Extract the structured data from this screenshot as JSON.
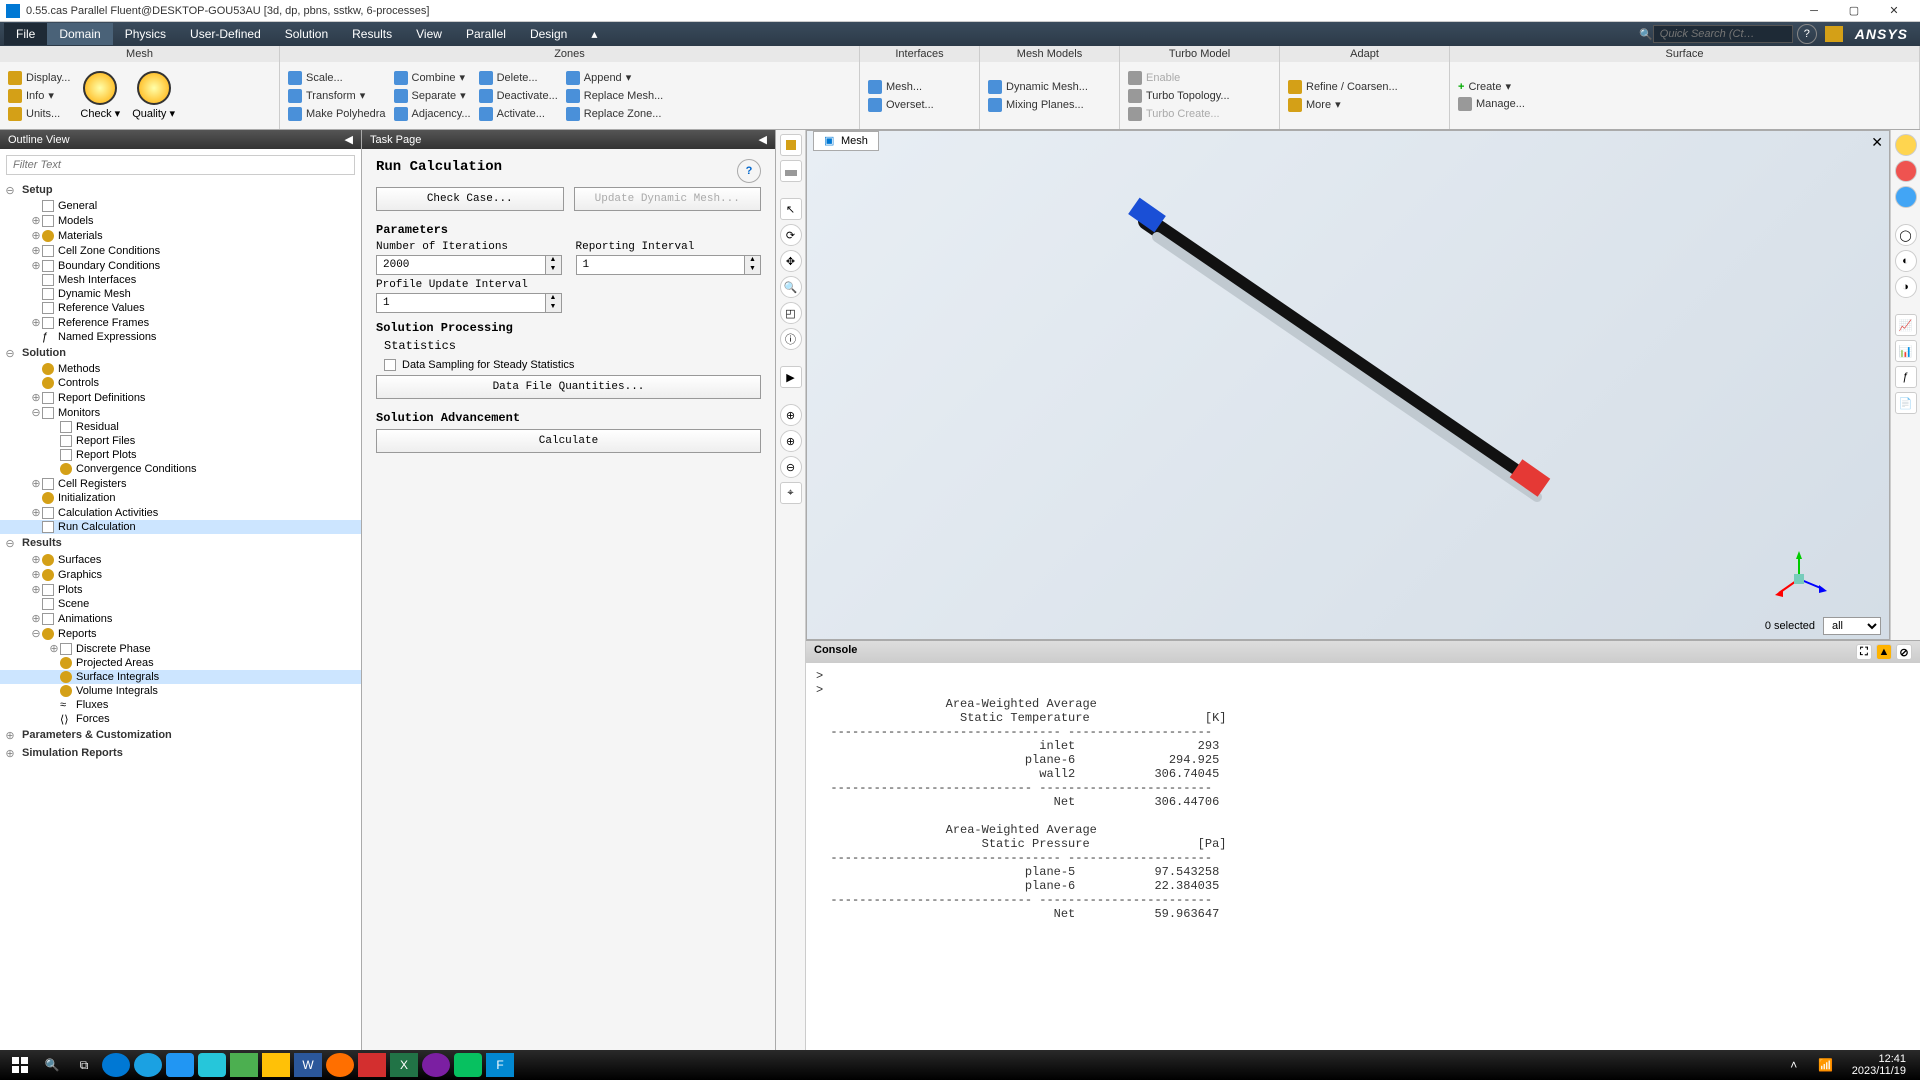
{
  "title_bar": {
    "title": "0.55.cas Parallel Fluent@DESKTOP-GOU53AU [3d, dp, pbns, sstkw, 6-processes]"
  },
  "menu": {
    "file": "File",
    "items": [
      "Domain",
      "Physics",
      "User-Defined",
      "Solution",
      "Results",
      "View",
      "Parallel",
      "Design"
    ],
    "search_placeholder": "Quick Search (Ct…",
    "brand": "ANSYS"
  },
  "ribbon": {
    "mesh": {
      "title": "Mesh",
      "display": "Display...",
      "info": "Info",
      "units": "Units...",
      "check": "Check ▾",
      "quality": "Quality ▾"
    },
    "zones_head": "Zones",
    "scale": "Scale...",
    "transform": "Transform",
    "poly": "Make Polyhedra",
    "combine": "Combine",
    "separate": "Separate",
    "adjacency": "Adjacency...",
    "delete": "Delete...",
    "deactivate": "Deactivate...",
    "activate": "Activate...",
    "append": "Append",
    "replace_mesh": "Replace Mesh...",
    "replace_zone": "Replace Zone...",
    "interfaces_head": "Interfaces",
    "mesh_iface": "Mesh...",
    "overset": "Overset...",
    "meshmodels_head": "Mesh Models",
    "dyn": "Dynamic Mesh...",
    "mix": "Mixing Planes...",
    "turbo_head": "Turbo Model",
    "enable": "Enable",
    "turbo_topo": "Turbo Topology...",
    "turbo_create": "Turbo Create...",
    "adapt_head": "Adapt",
    "refine": "Refine / Coarsen...",
    "more": "More",
    "surface_head": "Surface",
    "create": "Create",
    "manage": "Manage..."
  },
  "outline": {
    "title": "Outline View",
    "filter": "Filter Text",
    "setup": "Setup",
    "setup_items": [
      "General",
      "Models",
      "Materials",
      "Cell Zone Conditions",
      "Boundary Conditions",
      "Mesh Interfaces",
      "Dynamic Mesh",
      "Reference Values",
      "Reference Frames",
      "Named Expressions"
    ],
    "solution": "Solution",
    "solution_items": [
      "Methods",
      "Controls",
      "Report Definitions",
      "Monitors"
    ],
    "monitor_items": [
      "Residual",
      "Report Files",
      "Report Plots",
      "Convergence Conditions"
    ],
    "solution_items2": [
      "Cell Registers",
      "Initialization",
      "Calculation Activities",
      "Run Calculation"
    ],
    "results": "Results",
    "results_items": [
      "Surfaces",
      "Graphics",
      "Plots",
      "Scene",
      "Animations",
      "Reports"
    ],
    "reports_items": [
      "Discrete Phase",
      "Projected Areas",
      "Surface Integrals",
      "Volume Integrals",
      "Fluxes",
      "Forces"
    ],
    "params": "Parameters & Customization",
    "sim": "Simulation Reports"
  },
  "task": {
    "title": "Task Page",
    "heading": "Run Calculation",
    "check_case": "Check Case...",
    "update_dyn": "Update Dynamic Mesh...",
    "parameters": "Parameters",
    "num_iter_label": "Number of Iterations",
    "num_iter": "2000",
    "report_int_label": "Reporting Interval",
    "report_int": "1",
    "profile_label": "Profile Update Interval",
    "profile_int": "1",
    "sol_proc": "Solution Processing",
    "stats": "Statistics",
    "sampling": "Data Sampling for Steady Statistics",
    "dfq": "Data File Quantities...",
    "sol_adv": "Solution Advancement",
    "calculate": "Calculate"
  },
  "graphics": {
    "tab": "Mesh",
    "selection": "0 selected",
    "filter": "all"
  },
  "console": {
    "title": "Console",
    "text": ">\n>\n                  Area-Weighted Average\n                    Static Temperature                [K]\n  -------------------------------- --------------------\n                               inlet                 293\n                             plane-6             294.925\n                               wall2           306.74045\n  ---------------------------- ------------------------\n                                 Net           306.44706\n\n                  Area-Weighted Average\n                       Static Pressure               [Pa]\n  -------------------------------- --------------------\n                             plane-5           97.543258\n                             plane-6           22.384035\n  ---------------------------- ------------------------\n                                 Net           59.963647"
  },
  "taskbar": {
    "time": "12:41",
    "date": "2023/11/19"
  }
}
